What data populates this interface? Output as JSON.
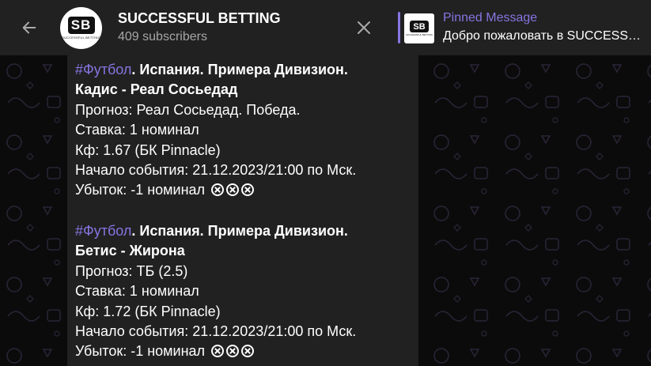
{
  "header": {
    "back_icon": "arrow-left-icon",
    "channel_name": "SUCCESSFUL BETTING",
    "subscribers": "409 subscribers",
    "avatar_text": "SB",
    "avatar_subtext": "SUCCESSFUL BETTING",
    "close_icon": "close-icon"
  },
  "pinned": {
    "label": "Pinned Message",
    "text": "Добро пожаловать в SUCCESSFUL BETTING",
    "thumb_text": "SB",
    "thumb_subtext": "SUCCESSFUL BETTING"
  },
  "colors": {
    "accent": "#8774e1",
    "topbar": "#212121",
    "bubble": "#212121"
  },
  "posts": [
    {
      "hashtag": "#Футбол",
      "league": ". Испания. Примера Дивизион.",
      "match": "Кадис - Реал Сосьедад",
      "forecast": "Прогноз: Реал Сосьедад. Победа.",
      "stake": "Ставка: 1 номинал",
      "odds": "Кф: 1.67 (БК Pinnacle)",
      "start": "Начало события: 21.12.2023/21:00 по Мск.",
      "result": "Убыток: -1 номинал",
      "result_icon": "cross-circle-icon"
    },
    {
      "hashtag": "#Футбол",
      "league": ". Испания. Примера Дивизион.",
      "match": "Бетис - Жирона",
      "forecast": "Прогноз: ТБ (2.5)",
      "stake": "Ставка: 1 номинал",
      "odds": "Кф: 1.72 (БК Pinnacle)",
      "start": "Начало события: 21.12.2023/21:00 по Мск.",
      "result": "Убыток: -1 номинал",
      "result_icon": "cross-circle-icon"
    }
  ]
}
